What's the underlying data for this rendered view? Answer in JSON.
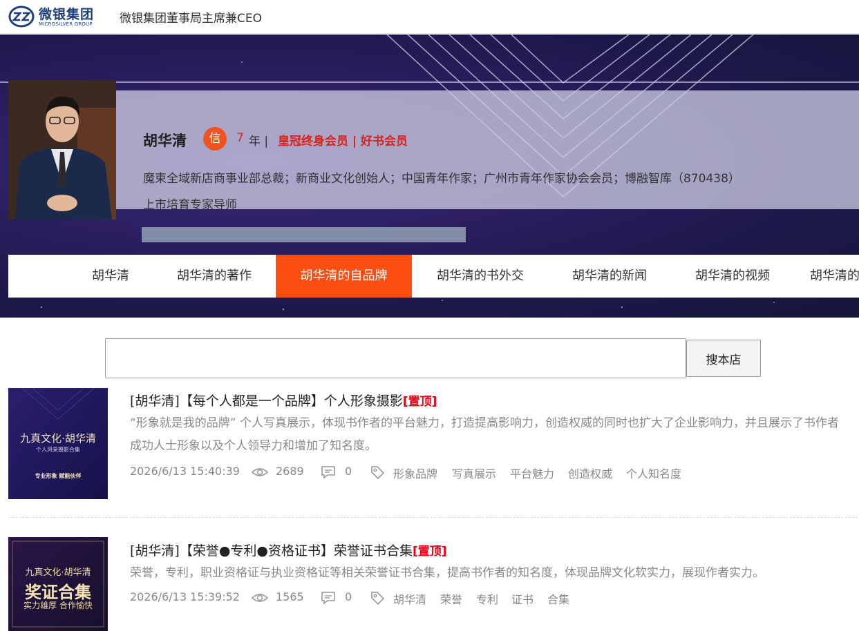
{
  "header": {
    "logo_name": "微银集团",
    "logo_sub": "MICROSILVER GROUP",
    "title": "微银集团董事局主席兼CEO"
  },
  "profile": {
    "name": "胡华清",
    "badge": "信",
    "years_num": "7",
    "years_unit": "年 |",
    "membership": "皇冠终身会员 | 好书会员",
    "description": "魔束全域新店商事业部总裁；新商业文化创始人；中国青年作家；广州市青年作家协会会员；博融智库（870438）上市培育专家导师"
  },
  "tabs": [
    {
      "label": "胡华清",
      "active": false
    },
    {
      "label": "胡华清的著作",
      "active": false
    },
    {
      "label": "胡华清的自品牌",
      "active": true
    },
    {
      "label": "胡华清的书外交",
      "active": false
    },
    {
      "label": "胡华清的新闻",
      "active": false
    },
    {
      "label": "胡华清的视频",
      "active": false
    },
    {
      "label": "胡华清的",
      "active": false
    }
  ],
  "search": {
    "value": "",
    "button_label": "搜本店"
  },
  "items": [
    {
      "thumb_line1": "九真文化·胡华清",
      "thumb_line2": "个人风采摄影合集",
      "thumb_line3": "专业形象 赋能伙伴",
      "title": "[胡华清]【每个人都是一个品牌】个人形象摄影",
      "pin": "[置顶]",
      "description": "“形象就是我的品牌” 个人写真展示，体现书作者的平台魅力，打造提高影响力，创造权威的同时也扩大了企业影响力，并且展示了书作者成功人士形象以及个人领导力和增加了知名度。",
      "date": "2026/6/13 15:40:39",
      "views": "2689",
      "comments": "0",
      "tags": [
        "形象品牌",
        "写真展示",
        "平台魅力",
        "创造权威",
        "个人知名度"
      ]
    },
    {
      "thumb_line1": "九真文化·胡华清",
      "thumb_line2": "奖证合集",
      "thumb_line3": "实力雄厚 合作愉快",
      "title": "[胡华清]【荣誉●专利●资格证书】荣誉证书合集",
      "pin": "[置顶]",
      "description": "荣誉，专利，职业资格证与执业资格证等相关荣誉证书合集，提高书作者的知名度，体现品牌文化软实力，展现作者实力。",
      "date": "2026/6/13 15:39:52",
      "views": "1565",
      "comments": "0",
      "tags": [
        "胡华清",
        "荣誉",
        "专利",
        "证书",
        "合集"
      ]
    }
  ]
}
